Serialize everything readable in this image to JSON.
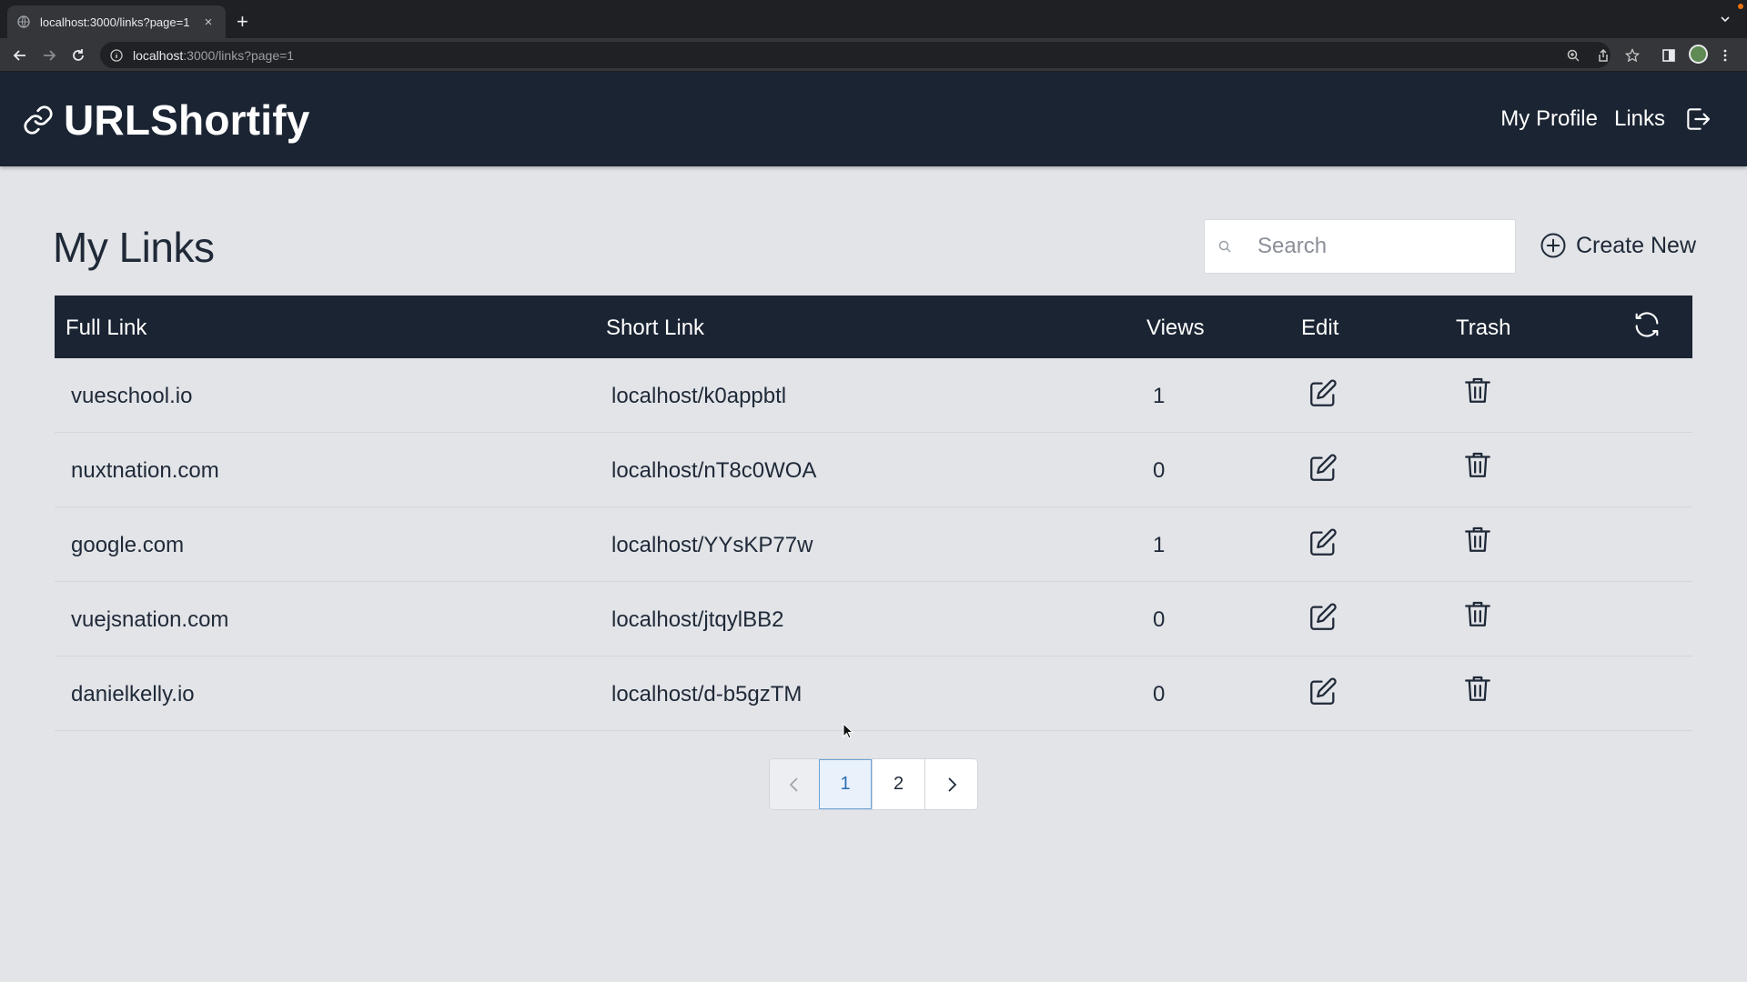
{
  "browser": {
    "tab_title": "localhost:3000/links?page=1",
    "tab_close": "×",
    "new_tab": "+",
    "url_host": "localhost",
    "url_path": ":3000/links?page=1"
  },
  "header": {
    "brand": "URLShortify",
    "nav": [
      "My Profile",
      "Links"
    ]
  },
  "page": {
    "title": "My Links",
    "search_placeholder": "Search",
    "search_value": "",
    "create_new_label": "Create New"
  },
  "table": {
    "columns": [
      "Full Link",
      "Short Link",
      "Views",
      "Edit",
      "Trash"
    ],
    "rows": [
      {
        "full": "vueschool.io",
        "short": "localhost/k0appbtl",
        "views": "1"
      },
      {
        "full": "nuxtnation.com",
        "short": "localhost/nT8c0WOA",
        "views": "0"
      },
      {
        "full": "google.com",
        "short": "localhost/YYsKP77w",
        "views": "1"
      },
      {
        "full": "vuejsnation.com",
        "short": "localhost/jtqylBB2",
        "views": "0"
      },
      {
        "full": "danielkelly.io",
        "short": "localhost/d-b5gzTM",
        "views": "0"
      }
    ]
  },
  "pagination": {
    "pages": [
      "1",
      "2"
    ],
    "current": "1"
  },
  "icons": {
    "brand": "link-icon",
    "logout": "logout-icon",
    "search": "search-icon",
    "create": "plus-circle-icon",
    "refresh": "refresh-icon",
    "edit": "edit-icon",
    "trash": "trash-icon"
  },
  "colors": {
    "header_bg": "#1b2433",
    "page_bg": "#e2e4e8",
    "active_page": "#2b6cb0"
  }
}
